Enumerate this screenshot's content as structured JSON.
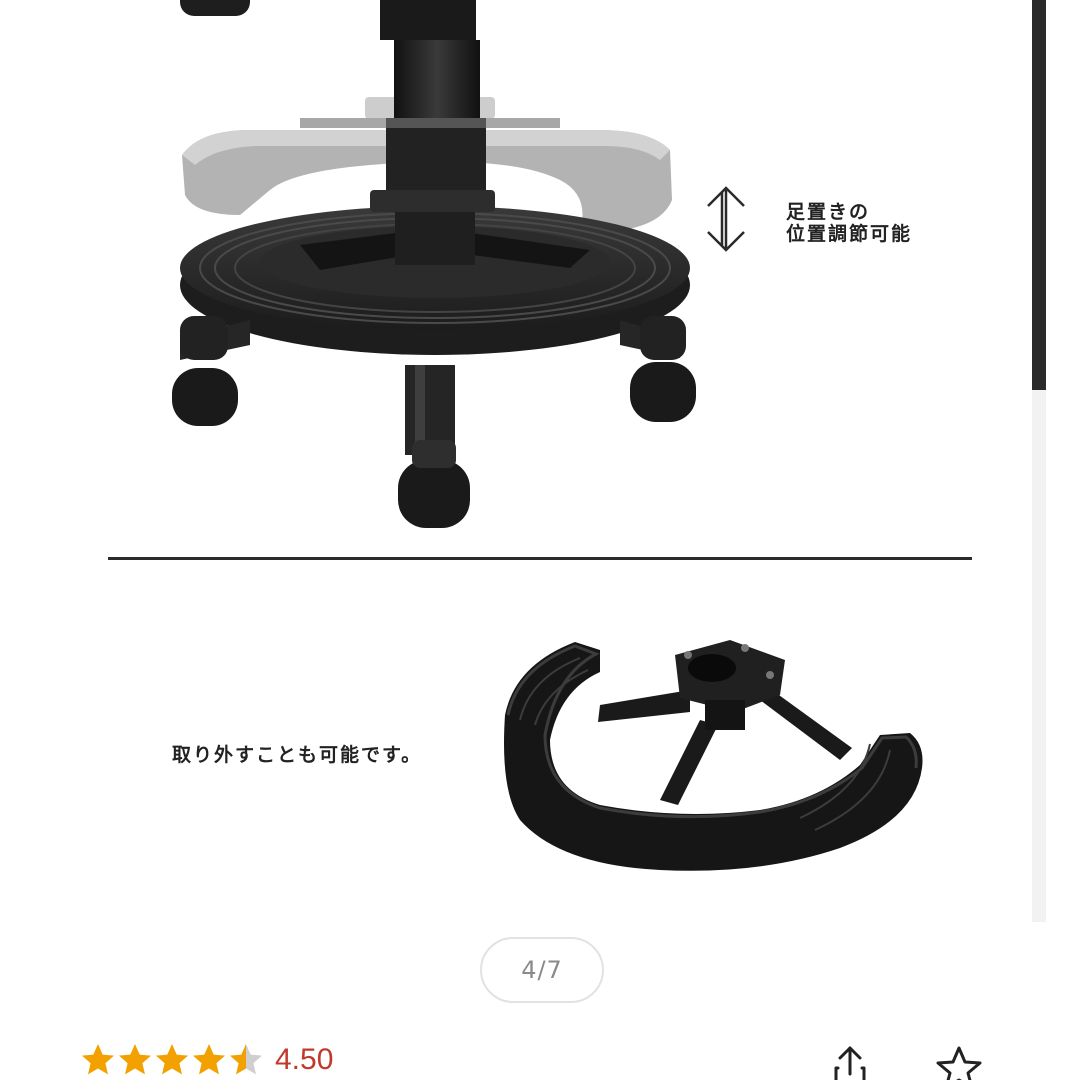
{
  "gallery": {
    "captions": {
      "footrest_height": "足置きの\n位置調節可能",
      "removable": "取り外すことも可能です。"
    },
    "counter": "4/7"
  },
  "product": {
    "rating": {
      "value": "4.50",
      "stars_filled": 4.5,
      "stars_total": 5
    }
  },
  "actions": {
    "share_icon": "share-icon",
    "favorite_icon": "star-outline-icon"
  },
  "colors": {
    "star_fill": "#f2a100",
    "star_empty": "#cfcfcf",
    "rating_text": "#c0392b",
    "counter_text": "#8a8a8a"
  }
}
